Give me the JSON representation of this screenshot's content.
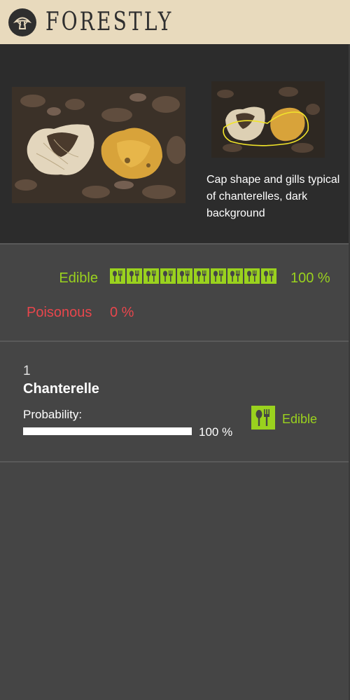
{
  "app": {
    "brand": "FORESTLY",
    "logo_icon": "mushroom-icon"
  },
  "hero": {
    "caption": "Cap shape and gills typical of chanterelles, dark background",
    "highlight_color": "#f2e52a"
  },
  "summary": {
    "edible_label": "Edible",
    "edible_pct": "100 %",
    "edible_fraction": 1.0,
    "icon_count": 10,
    "edible_icon": "cutlery-icon",
    "poisonous_label": "Poisonous",
    "poisonous_pct": "0 %"
  },
  "results": [
    {
      "rank": "1",
      "name": "Chanterelle",
      "probability_label": "Probability:",
      "probability_pct": "100 %",
      "probability_fraction": 1.0,
      "edibility": "Edible",
      "edibility_icon": "cutlery-icon"
    }
  ],
  "colors": {
    "header_bg": "#e8dabd",
    "edible": "#9ad21e",
    "poisonous": "#e8464c",
    "panel": "#454545",
    "hero_bg": "#2c2c2c"
  }
}
